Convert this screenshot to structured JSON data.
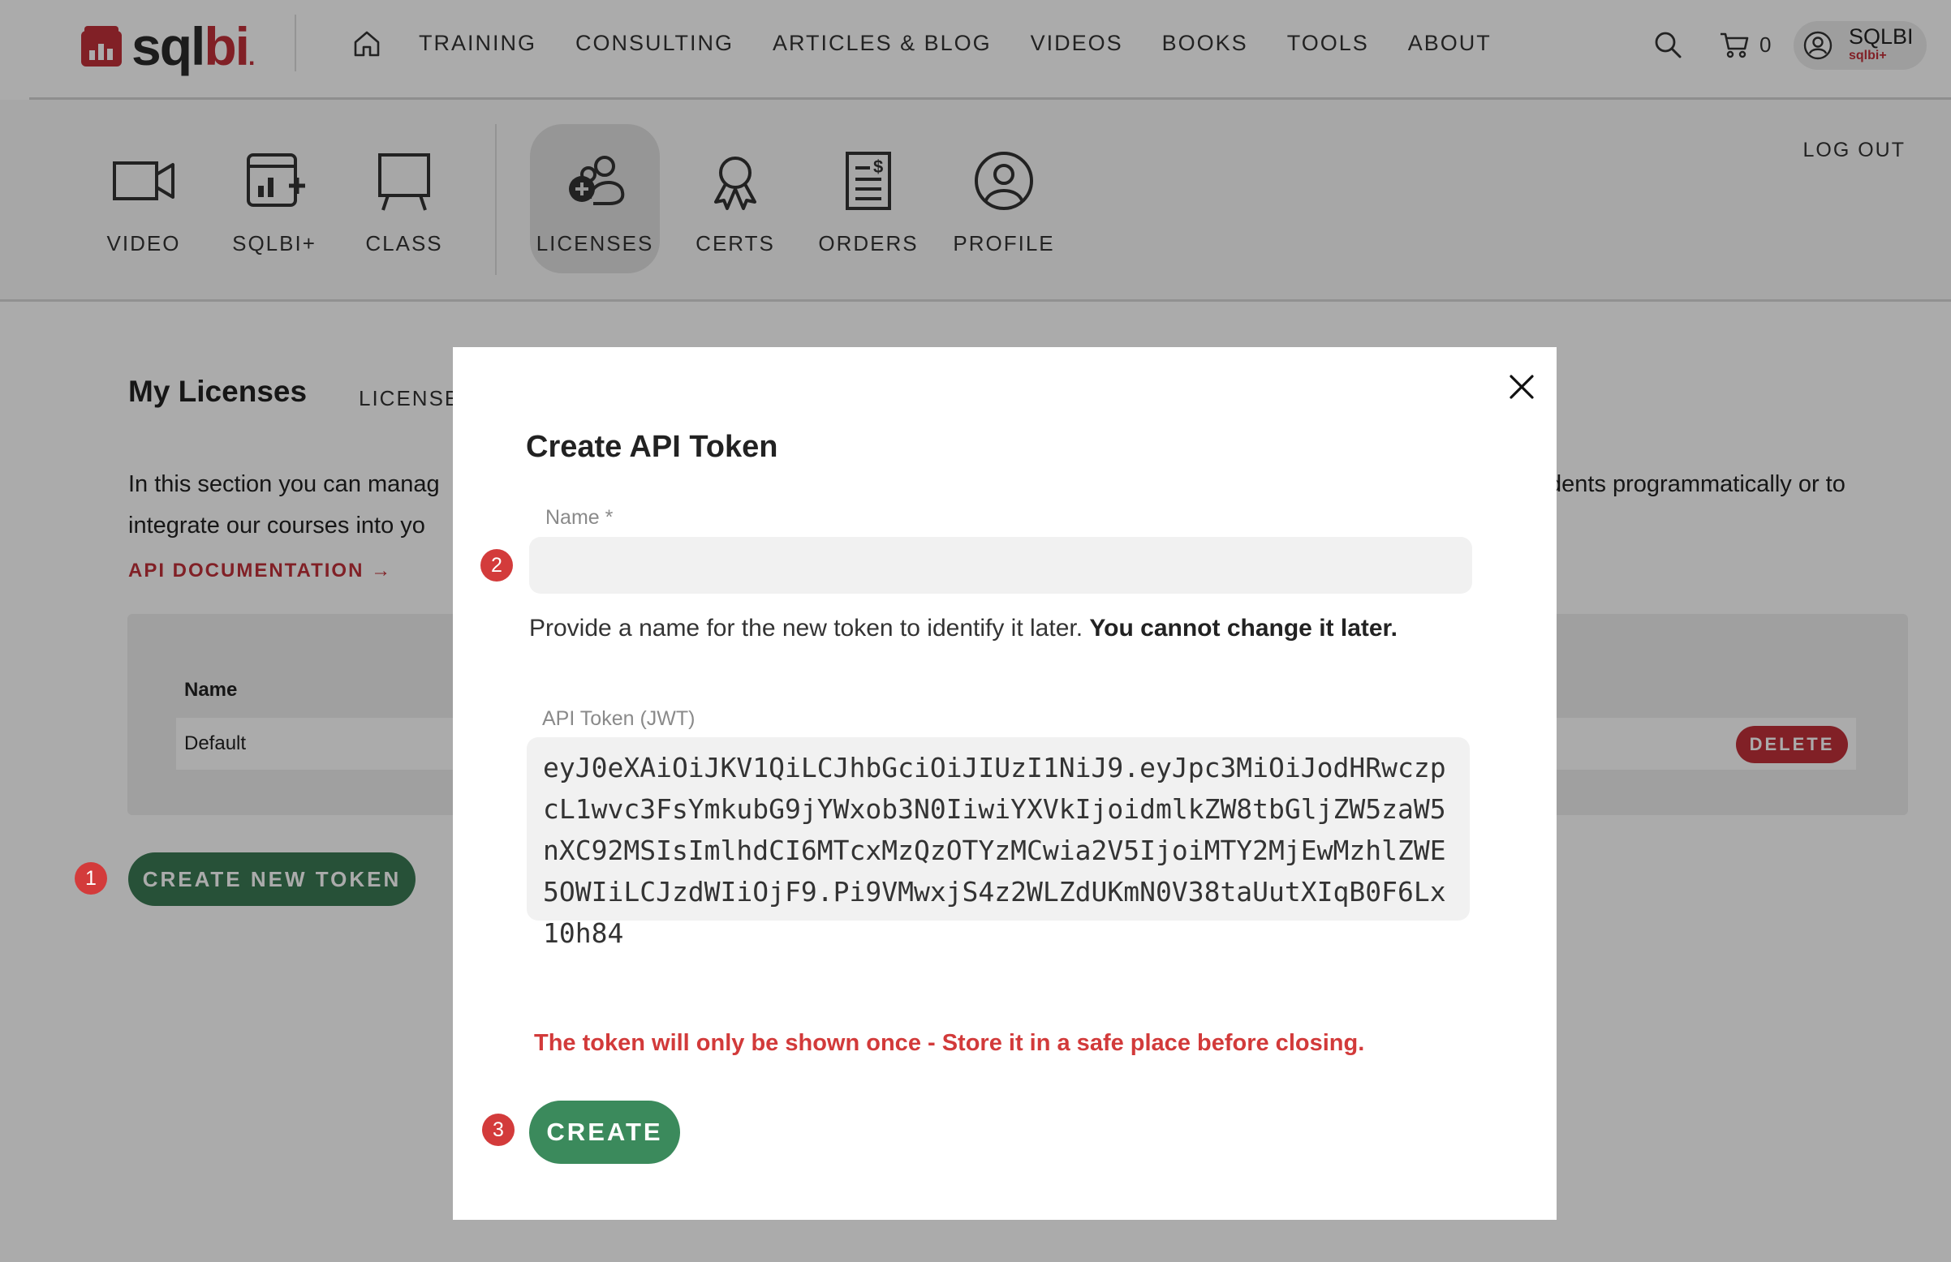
{
  "brand": {
    "sq": "sql",
    "bi": "bi",
    "dot": "."
  },
  "nav": {
    "items": [
      "TRAINING",
      "CONSULTING",
      "ARTICLES & BLOG",
      "VIDEOS",
      "BOOKS",
      "TOOLS",
      "ABOUT"
    ]
  },
  "cart": {
    "count": "0"
  },
  "user": {
    "name": "SQLBI",
    "plan": "sqlbi+"
  },
  "subnav": {
    "items": [
      "VIDEO",
      "SQLBI+",
      "CLASS",
      "LICENSES",
      "CERTS",
      "ORDERS",
      "PROFILE"
    ],
    "active": "LICENSES",
    "logout": "LOG OUT"
  },
  "page": {
    "title": "My Licenses",
    "tab": "LICENSE",
    "desc_left_1": "In this section you can manag",
    "desc_left_2": "integrate our courses into yo",
    "desc_right": "dents programmatically or to",
    "api_doc": "API DOCUMENTATION →",
    "table_header": "Name",
    "row_name": "Default",
    "delete": "DELETE",
    "create_new": "CREATE NEW TOKEN"
  },
  "modal": {
    "title": "Create API Token",
    "name_label": "Name *",
    "name_value": "",
    "help_text": "Provide a name for the new token to identify it later. ",
    "help_bold": "You cannot change it later.",
    "token_label": "API Token (JWT)",
    "token": "eyJ0eXAiOiJKV1QiLCJhbGciOiJIUzI1NiJ9.eyJpc3MiOiJodHRwczpcL1wvc3FsYmkubG9jYWxob3N0IiwiYXVkIjoidmlkZW8tbGljZW5zaW5nXC92MSIsImlhdCI6MTcxMzQzOTYzMCwia2V5IjoiMTY2MjEwMzhlZWE5OWIiLCJzdWIiOjF9.Pi9VMwxjS4z2WLZdUKmN0V38taUutXIqB0F6Lx10h84",
    "warning": "The token will only be shown once - Store it in a safe place before closing.",
    "create": "CREATE"
  },
  "steps": {
    "one": "1",
    "two": "2",
    "three": "3"
  },
  "colors": {
    "brand_red": "#c0303a",
    "button_green": "#3b8a5c",
    "badge_red": "#d33b3b"
  }
}
